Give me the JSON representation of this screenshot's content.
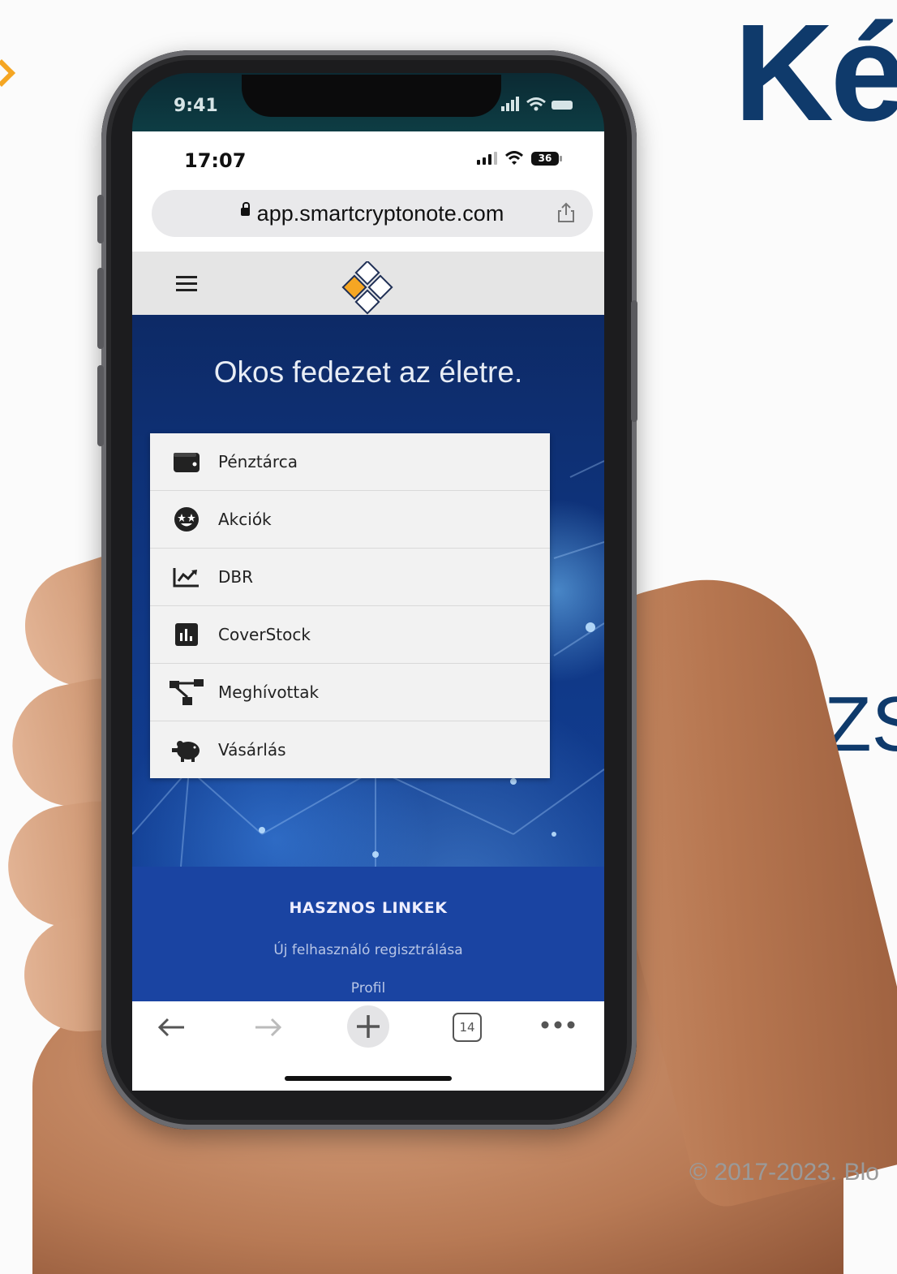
{
  "background": {
    "headline": "Ké",
    "side_text": "ZS",
    "copyright": "© 2017-2023. Blo"
  },
  "phone_outer_status": {
    "time": "9:41"
  },
  "browser": {
    "status_time": "17:07",
    "battery": "36",
    "url": "app.smartcryptonote.com"
  },
  "site": {
    "hero_title": "Okos fedezet az életre.",
    "menu": [
      {
        "label": "Pénztárca",
        "icon": "wallet-icon"
      },
      {
        "label": "Akciók",
        "icon": "star-eyes-emoji-icon"
      },
      {
        "label": "DBR",
        "icon": "trending-chart-icon"
      },
      {
        "label": "CoverStock",
        "icon": "bar-chart-box-icon"
      },
      {
        "label": "Meghívottak",
        "icon": "network-tree-icon"
      },
      {
        "label": "Vásárlás",
        "icon": "piggy-bank-icon"
      }
    ],
    "footer": {
      "title": "HASZNOS LINKEK",
      "links": [
        "Új felhasználó regisztrálása",
        "Profil"
      ]
    }
  },
  "toolbar": {
    "tab_count": "14"
  },
  "colors": {
    "accent": "#f5a623",
    "brand_blue": "#0f3a6b",
    "hero_blue": "#0f3580",
    "footer_blue": "#1a44a2"
  }
}
